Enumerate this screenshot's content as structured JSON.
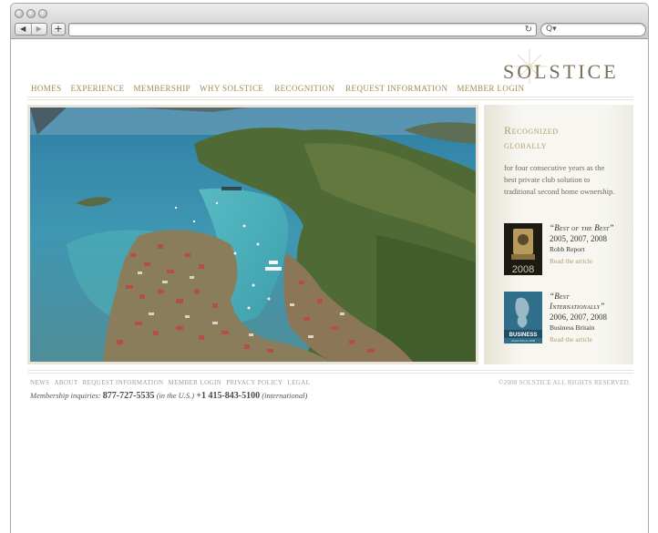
{
  "browser": {
    "back_glyph": "◀",
    "forward_glyph": "▶",
    "add_glyph": "+",
    "reload_glyph": "↻",
    "search_glyph": "Q▾",
    "url_value": "",
    "search_value": ""
  },
  "site": {
    "logo": "SOLSTICE",
    "nav": [
      "HOMES",
      "EXPERIENCE",
      "MEMBERSHIP",
      "WHY SOLSTICE",
      "RECOGNITION",
      "REQUEST INFORMATION",
      "MEMBER LOGIN"
    ]
  },
  "sidebar": {
    "title_line1": "Recognized",
    "title_line2": "globally",
    "text": "for four consecutive years as the best private club solution to traditional second home ownership.",
    "awards": [
      {
        "quote_line1": "“Best of the Best”",
        "quote_line2": "",
        "years": "2005, 2007, 2008",
        "source": "Robb Report",
        "link": "Read the article",
        "badge_text": "2008"
      },
      {
        "quote_line1": "“Best",
        "quote_line2": "Internationally”",
        "years": "2006, 2007, 2008",
        "source": "Business Britain",
        "link": "Read the article",
        "badge_text": "BUSINESS",
        "badge_subtext": "Award Winner 2008"
      }
    ]
  },
  "footer": {
    "links": [
      "NEWS",
      "ABOUT",
      "REQUEST INFORMATION",
      "MEMBER LOGIN",
      "PRIVACY POLICY",
      "LEGAL"
    ],
    "copyright": "©2008 SOLSTICE ALL RIGHTS RESERVED.",
    "inquiry_label": "Membership inquiries:",
    "phone_us": "877-727-5535",
    "phone_us_note": "(in the U.S.)",
    "phone_intl": "+1 415-843-5100",
    "phone_intl_note": "(international)"
  },
  "colors": {
    "gold": "#a38a52",
    "logo": "#7a6f5c",
    "sea": "#3c8fae",
    "land": "#4f6a34",
    "roofs": "#b84a4a"
  }
}
